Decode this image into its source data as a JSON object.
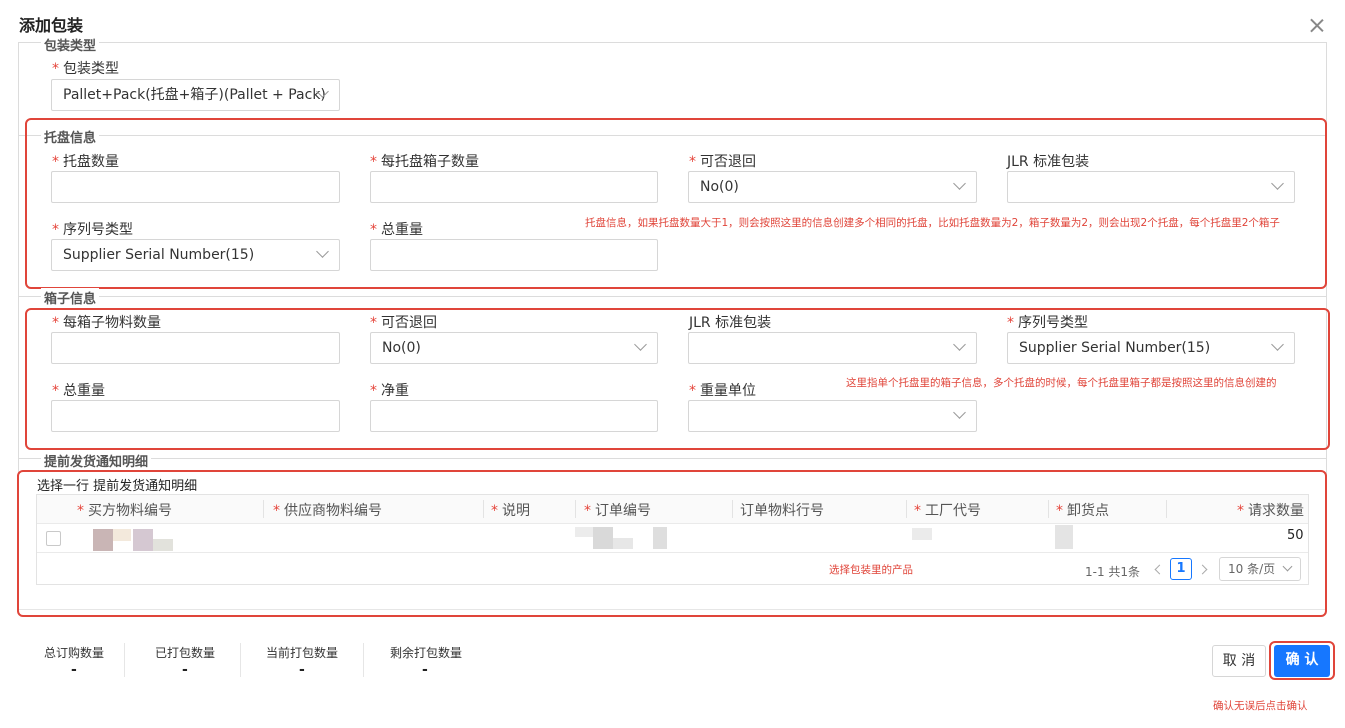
{
  "dialog": {
    "title": "添加包装"
  },
  "package_type": {
    "section_title": "包装类型",
    "label": "包装类型",
    "value": "Pallet+Pack(托盘+箱子)(Pallet + Pack)"
  },
  "pallet": {
    "section_title": "托盘信息",
    "fields": {
      "count_label": "托盘数量",
      "boxes_per_pallet_label": "每托盘箱子数量",
      "returnable_label": "可否退回",
      "returnable_value": "No(0)",
      "jlr_label": "JLR 标准包装",
      "serial_type_label": "序列号类型",
      "serial_type_value": "Supplier Serial Number(15)",
      "gross_weight_label": "总重量"
    },
    "note": "托盘信息，如果托盘数量大于1，则会按照这里的信息创建多个相同的托盘，比如托盘数量为2，箱子数量为2，则会出现2个托盘，每个托盘里2个箱子"
  },
  "box": {
    "section_title": "箱子信息",
    "fields": {
      "qty_per_box_label": "每箱子物料数量",
      "returnable_label": "可否退回",
      "returnable_value": "No(0)",
      "jlr_label": "JLR 标准包装",
      "serial_type_label": "序列号类型",
      "serial_type_value": "Supplier Serial Number(15)",
      "gross_weight_label": "总重量",
      "net_weight_label": "净重",
      "weight_unit_label": "重量单位"
    },
    "note": "这里指单个托盘里的箱子信息，多个托盘的时候，每个托盘里箱子都是按照这里的信息创建的"
  },
  "asn": {
    "section_title": "提前发货通知明细",
    "select_hint": "选择一行 提前发货通知明细",
    "columns": [
      {
        "label": "买方物料编号",
        "required": true
      },
      {
        "label": "供应商物料编号",
        "required": true
      },
      {
        "label": "说明",
        "required": true
      },
      {
        "label": "订单编号",
        "required": true
      },
      {
        "label": "订单物料行号",
        "required": false
      },
      {
        "label": "工厂代号",
        "required": true
      },
      {
        "label": "卸货点",
        "required": true
      },
      {
        "label": "请求数量",
        "required": true
      }
    ],
    "rows": [
      {
        "qty": "50"
      }
    ],
    "note": "选择包装里的产品",
    "pagination": {
      "summary": "1-1 共1条",
      "current_page": "1",
      "page_size": "10 条/页"
    }
  },
  "stats": [
    {
      "label": "总订购数量",
      "value": "-"
    },
    {
      "label": "已打包数量",
      "value": "-"
    },
    {
      "label": "当前打包数量",
      "value": "-"
    },
    {
      "label": "剩余打包数量",
      "value": "-"
    }
  ],
  "footer": {
    "cancel_label": "取 消",
    "confirm_label": "确 认",
    "note": "确认无误后点击确认"
  },
  "colors": {
    "primary": "#1677ff",
    "annotation_red": "#e0453a",
    "required_star": "#e5443a"
  }
}
